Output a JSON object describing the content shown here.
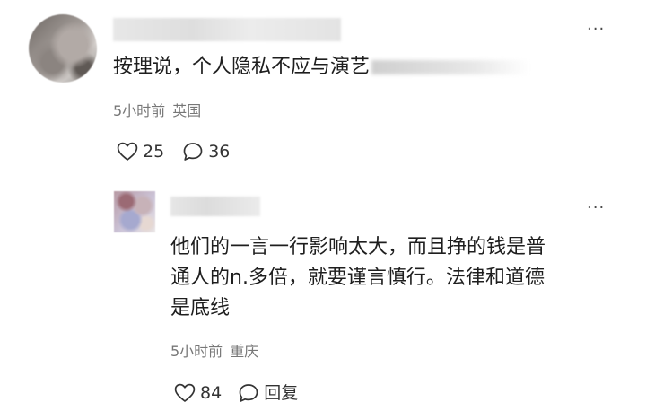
{
  "comments": [
    {
      "content_visible": "按理说，个人隐私不应与演艺",
      "time": "5小时前",
      "location": "英国",
      "like_count": "25",
      "reply_count": "36",
      "icons": [
        "heart-icon",
        "comment-bubble-icon",
        "more-dots-icon"
      ]
    },
    {
      "content_lines": [
        "他们的一言一行影响太大，而且挣的钱是普",
        "通人的n.多倍，就要谨言慎行。法律和道德",
        "是底线"
      ],
      "time": "5小时前",
      "location": "重庆",
      "like_count": "84",
      "reply_label": "回复",
      "icons": [
        "heart-icon",
        "comment-bubble-icon",
        "more-dots-icon"
      ]
    }
  ],
  "more_glyph": "···",
  "colors": {
    "text_primary": "#1e1e1e",
    "text_meta": "#777777",
    "icon_stroke": "#333333",
    "background": "#ffffff"
  }
}
